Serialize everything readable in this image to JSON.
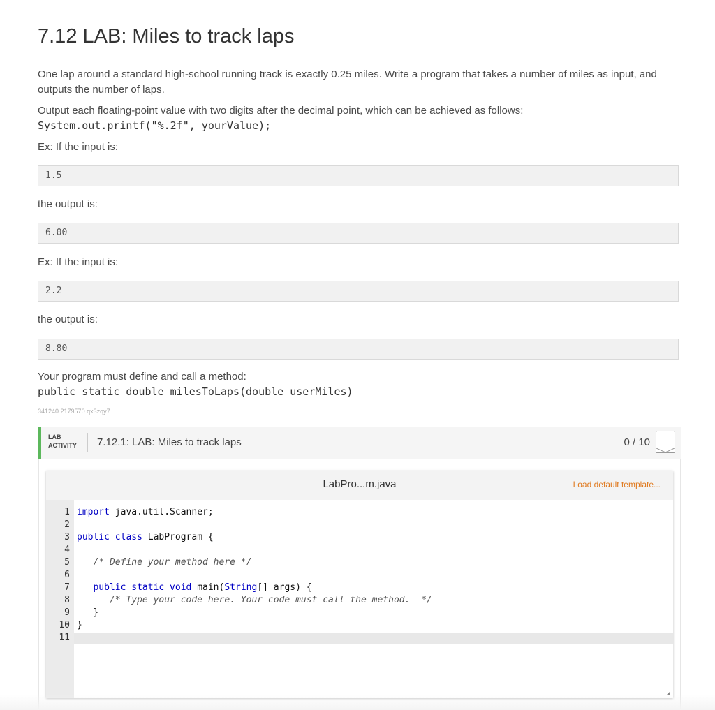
{
  "page": {
    "title": "7.12 LAB: Miles to track laps",
    "intro": "One lap around a standard high-school running track is exactly 0.25 miles. Write a program that takes a number of miles as input, and outputs the number of laps.",
    "format_note": "Output each floating-point value with two digits after the decimal point, which can be achieved as follows:",
    "format_code": "System.out.printf(\"%.2f\", yourValue);",
    "ex1_label": "Ex: If the input is:",
    "ex1_input": "1.5",
    "ex1_output_label": "the output is:",
    "ex1_output": "6.00",
    "ex2_label": "Ex: If the input is:",
    "ex2_input": "2.2",
    "ex2_output_label": "the output is:",
    "ex2_output": "8.80",
    "method_note": "Your program must define and call a method:",
    "method_signature": "public static double milesToLaps(double userMiles)",
    "content_id": "341240.2179570.qx3zqy7"
  },
  "lab": {
    "tag_line1": "LAB",
    "tag_line2": "ACTIVITY",
    "title": "7.12.1: LAB: Miles to track laps",
    "score": "0 / 10",
    "accent_color": "#5cb85c"
  },
  "editor": {
    "filename": "LabPro...m.java",
    "load_template": "Load default template...",
    "load_template_color": "#e07a1f",
    "line_numbers": [
      "1",
      "2",
      "3",
      "4",
      "5",
      "6",
      "7",
      "8",
      "9",
      "10",
      "11"
    ],
    "lines": {
      "l1_kw": "import",
      "l1_rest": " java.util.Scanner;",
      "l3_kw": "public class",
      "l3_rest": " LabProgram {",
      "l5_comment": "   /* Define your method here */",
      "l7_kw": "   public static void",
      "l7_rest": " main(",
      "l7_type": "String",
      "l7_end": "[] args) {",
      "l8_comment": "      /* Type your code here. Your code must call the method.  */",
      "l9": "   }",
      "l10": "}"
    }
  }
}
